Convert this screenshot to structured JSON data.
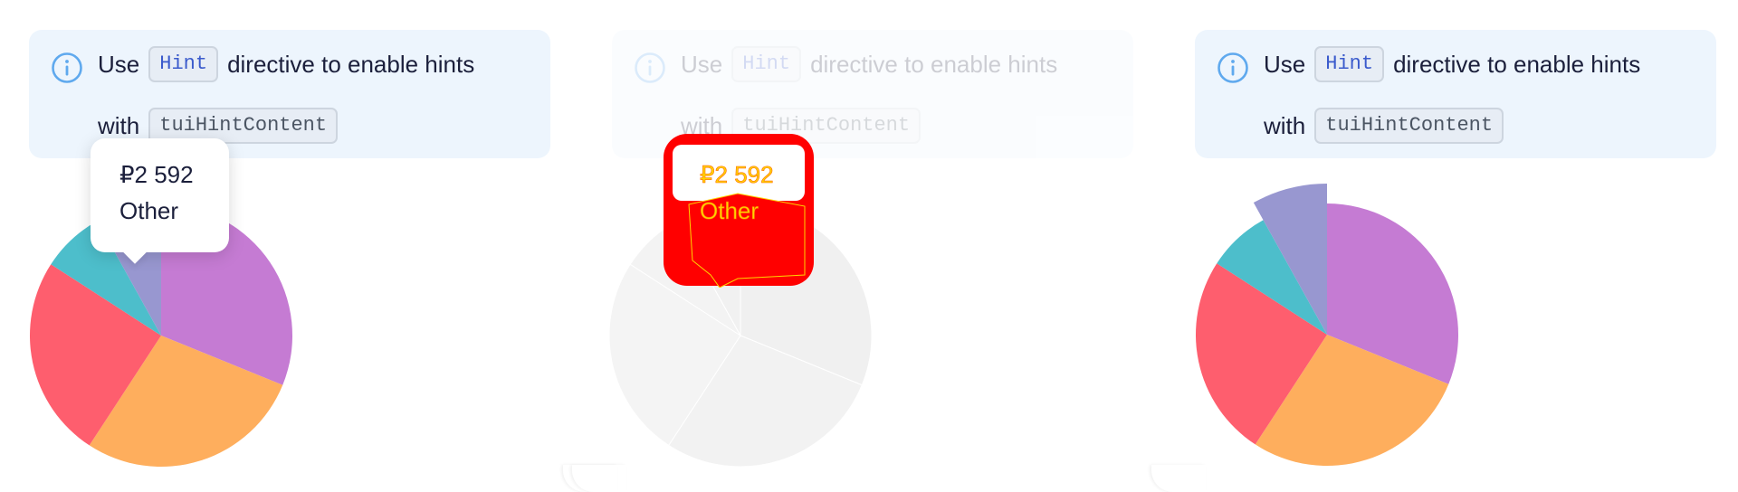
{
  "notice": {
    "text_use": "Use",
    "code_hint": "Hint",
    "text_directive": "directive to enable hints",
    "text_with": "with",
    "code_content": "tuiHintContent"
  },
  "tooltip": {
    "value": "₽2 592",
    "label": "Other"
  },
  "colors": {
    "purple": "#c57bd3",
    "orange": "#feae5d",
    "red": "#fe5e6e",
    "teal": "#4dbecb",
    "lavender": "#9897d0",
    "notice_bg": "#edf5fd",
    "info_icon": "#5fa9ee"
  },
  "chart_data": [
    {
      "type": "pie",
      "categories": [
        "",
        "",
        "",
        "",
        "Other"
      ],
      "values": [
        10,
        9,
        8,
        2.5,
        2.592
      ],
      "highlighted": "Other"
    },
    {
      "type": "pie",
      "categories": [
        "",
        "",
        "",
        "",
        "Other"
      ],
      "values": [
        10,
        9,
        8,
        2.5,
        2.592
      ],
      "highlighted": "Other",
      "state": "disabled"
    },
    {
      "type": "pie",
      "categories": [
        "",
        "",
        "",
        "",
        "Other"
      ],
      "values": [
        10,
        9,
        8,
        2.5,
        2.592
      ],
      "highlighted": "Other",
      "state": "slice-offset"
    }
  ]
}
